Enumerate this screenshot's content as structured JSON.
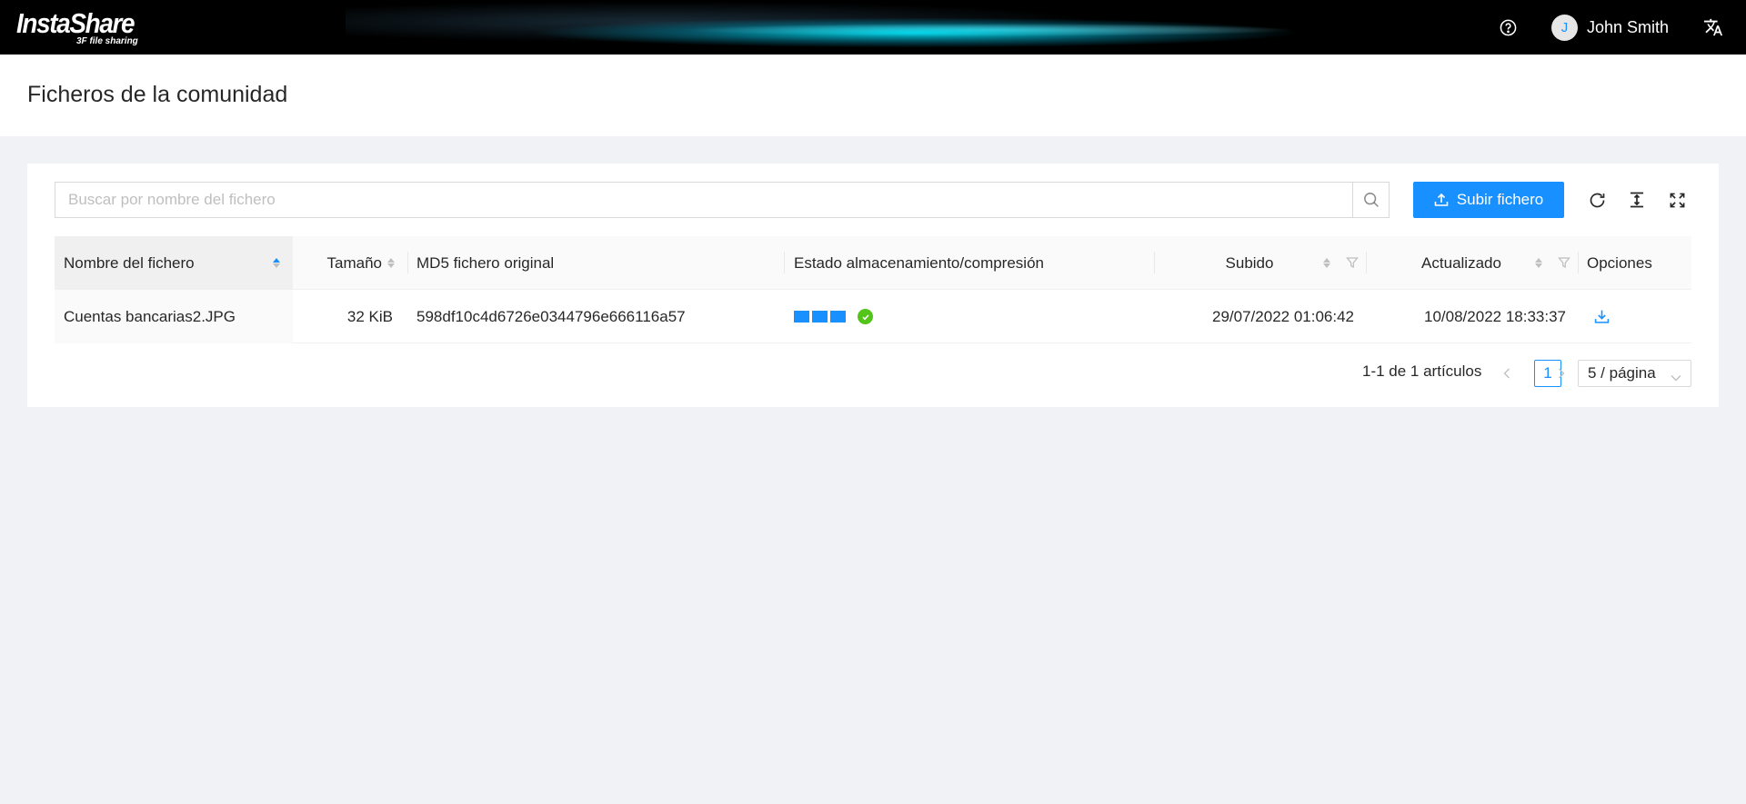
{
  "header": {
    "logo_main": "InstaShare",
    "logo_sub": "3F file sharing",
    "user": {
      "avatar_initial": "J",
      "name": "John Smith"
    },
    "icons": [
      "help-icon",
      "translate-icon"
    ]
  },
  "page": {
    "title": "Ficheros de la comunidad"
  },
  "toolbar": {
    "search_placeholder": "Buscar por nombre del fichero",
    "upload_label": "Subir fichero",
    "icons": [
      "reload-icon",
      "column-height-icon",
      "fullscreen-icon"
    ]
  },
  "table": {
    "columns": {
      "name": "Nombre del fichero",
      "size": "Tamaño",
      "md5": "MD5 fichero original",
      "status": "Estado almacenamiento/compresión",
      "uploaded": "Subido",
      "updated": "Actualizado",
      "options": "Opciones"
    },
    "rows": [
      {
        "name": "Cuentas bancarias2.JPG",
        "size": "32 KiB",
        "md5": "598df10c4d6726e0344796e666116a57",
        "status_steps_done": 3,
        "status_complete": true,
        "uploaded": "29/07/2022 01:06:42",
        "updated": "10/08/2022 18:33:37"
      }
    ]
  },
  "pagination": {
    "total_text": "1-1 de 1 artículos",
    "current_page": "1",
    "page_size": "5 / página"
  },
  "colors": {
    "primary": "#1890ff",
    "success": "#52c41a",
    "header_bg": "#000000"
  }
}
